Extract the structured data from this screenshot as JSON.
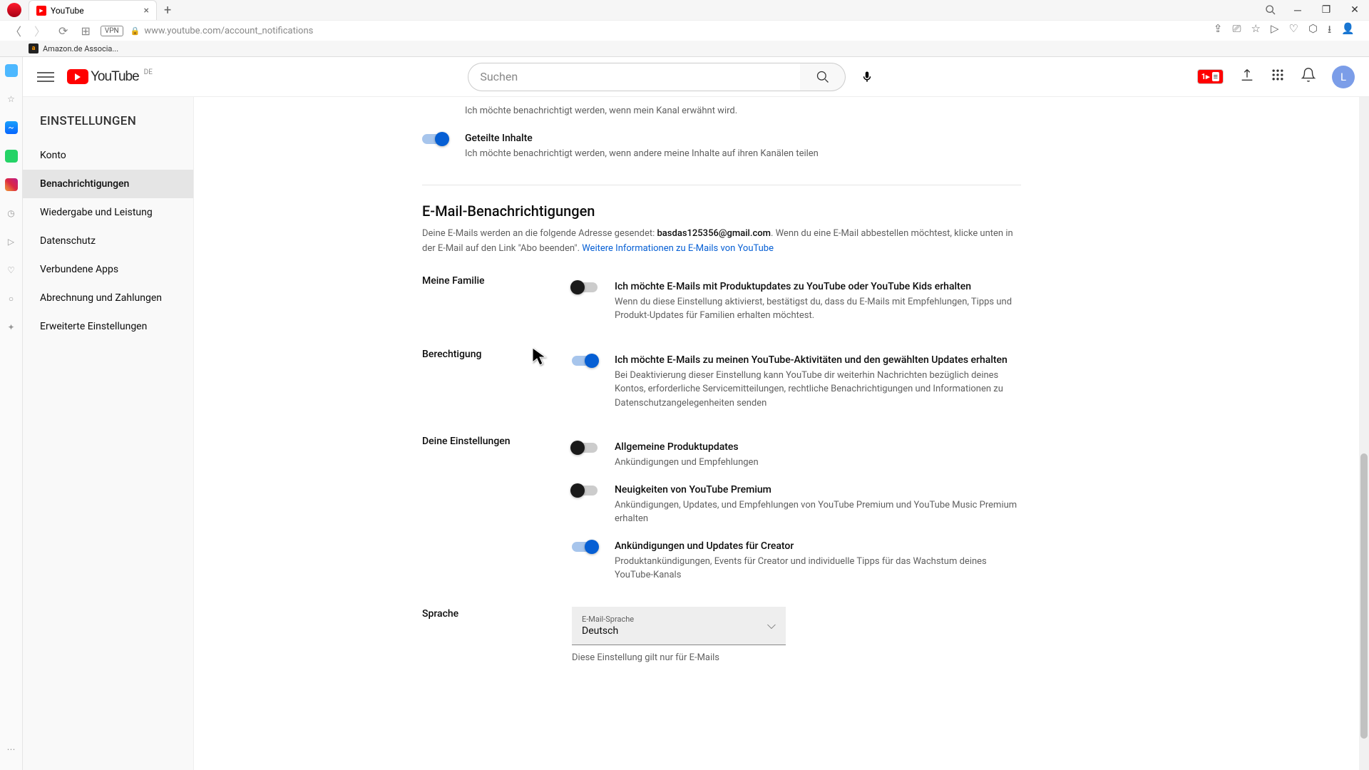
{
  "browser": {
    "tab_title": "YouTube",
    "url": "www.youtube.com/account_notifications",
    "vpn": "VPN",
    "bookmark": "Amazon.de Associa..."
  },
  "header": {
    "logo_text": "YouTube",
    "logo_region": "DE",
    "search_placeholder": "Suchen",
    "ext_badge": "1▸",
    "avatar_letter": "L"
  },
  "sidebar": {
    "title": "EINSTELLUNGEN",
    "items": [
      {
        "label": "Konto"
      },
      {
        "label": "Benachrichtigungen"
      },
      {
        "label": "Wiedergabe und Leistung"
      },
      {
        "label": "Datenschutz"
      },
      {
        "label": "Verbundene Apps"
      },
      {
        "label": "Abrechnung und Zahlungen"
      },
      {
        "label": "Erweiterte Einstellungen"
      }
    ]
  },
  "content": {
    "top_desc": "Ich möchte benachrichtigt werden, wenn mein Kanal erwähnt wird.",
    "shared": {
      "title": "Geteilte Inhalte",
      "desc": "Ich möchte benachrichtigt werden, wenn andere meine Inhalte auf ihren Kanälen teilen"
    },
    "email_section": {
      "heading": "E-Mail-Benachrichtigungen",
      "sub_pre": "Deine E-Mails werden an die folgende Adresse gesendet: ",
      "email": "basdas125356@gmail.com",
      "sub_post": ". Wenn du eine E-Mail abbestellen möchtest, klicke unten in der E-Mail auf den Link \"Abo beenden\". ",
      "link": "Weitere Informationen zu E-Mails von YouTube"
    },
    "family": {
      "label": "Meine Familie",
      "title": "Ich möchte E-Mails mit Produktupdates zu YouTube oder YouTube Kids erhalten",
      "desc": "Wenn du diese Einstellung aktivierst, bestätigst du, dass du E-Mails mit Empfehlungen, Tipps und Produkt-Updates für Familien erhalten möchtest."
    },
    "permission": {
      "label": "Berechtigung",
      "title": "Ich möchte E-Mails zu meinen YouTube-Aktivitäten und den gewählten Updates erhalten",
      "desc": "Bei Deaktivierung dieser Einstellung kann YouTube dir weiterhin Nachrichten bezüglich deines Kontos, erforderliche Servicemitteilungen, rechtliche Benachrichtigungen und Informationen zu Datenschutzangelegenheiten senden"
    },
    "prefs": {
      "label": "Deine Einstellungen",
      "p1_title": "Allgemeine Produktupdates",
      "p1_desc": "Ankündigungen und Empfehlungen",
      "p2_title": "Neuigkeiten von YouTube Premium",
      "p2_desc": "Ankündigungen, Updates, und Empfehlungen von YouTube Premium und YouTube Music Premium erhalten",
      "p3_title": "Ankündigungen und Updates für Creator",
      "p3_desc": "Produktankündigungen, Events für Creator und individuelle Tipps für das Wachstum deines YouTube-Kanals"
    },
    "language": {
      "label": "Sprache",
      "field_label": "E-Mail-Sprache",
      "value": "Deutsch",
      "note": "Diese Einstellung gilt nur für E-Mails"
    }
  }
}
